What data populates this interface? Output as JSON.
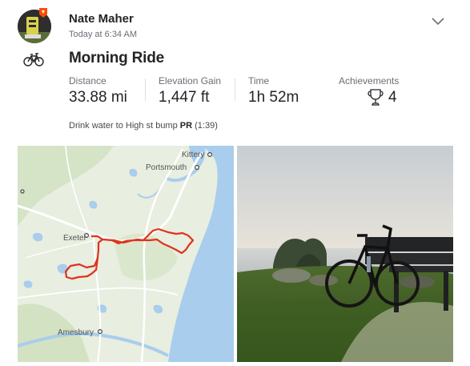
{
  "athlete": {
    "name": "Nate Maher",
    "timestamp": "Today at 6:34 AM"
  },
  "activity": {
    "icon": "bike-icon",
    "title": "Morning Ride",
    "stats": [
      {
        "label": "Distance",
        "value": "33.88 mi"
      },
      {
        "label": "Elevation Gain",
        "value": "1,447 ft"
      },
      {
        "label": "Time",
        "value": "1h 52m"
      }
    ],
    "achievements": {
      "label": "Achievements",
      "count": "4"
    },
    "segment": {
      "name": "Drink water to High st bump",
      "badge": "PR",
      "time": "(1:39)"
    }
  },
  "map": {
    "places": {
      "kittery": "Kittery",
      "portsmouth": "Portsmouth",
      "exeter": "Exeter",
      "amesbury": "Amesbury"
    }
  },
  "colors": {
    "route": "#e0321d",
    "water": "#a9cdec",
    "accent": "#fc4c02"
  }
}
